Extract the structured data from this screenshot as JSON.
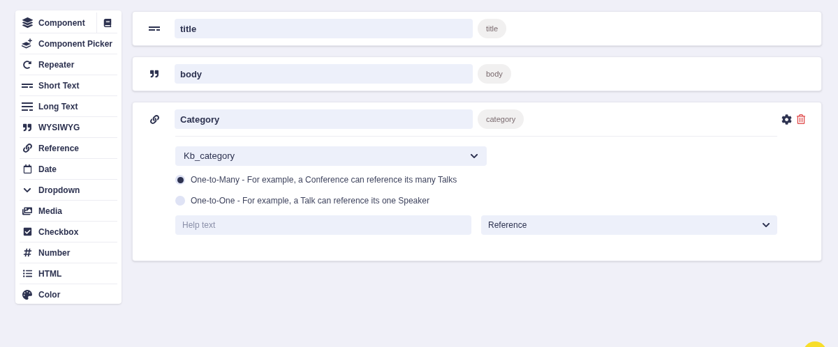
{
  "sidebar": {
    "items": [
      {
        "kind": "component",
        "label": "Component"
      },
      {
        "kind": "picker",
        "label": "Component Picker"
      },
      {
        "kind": "repeater",
        "label": "Repeater"
      },
      {
        "kind": "short_text",
        "label": "Short Text"
      },
      {
        "kind": "long_text",
        "label": "Long Text"
      },
      {
        "kind": "wysiwyg",
        "label": "WYSIWYG"
      },
      {
        "kind": "reference",
        "label": "Reference"
      },
      {
        "kind": "date",
        "label": "Date"
      },
      {
        "kind": "dropdown",
        "label": "Dropdown"
      },
      {
        "kind": "media",
        "label": "Media"
      },
      {
        "kind": "checkbox",
        "label": "Checkbox"
      },
      {
        "kind": "number",
        "label": "Number"
      },
      {
        "kind": "html",
        "label": "HTML"
      },
      {
        "kind": "color",
        "label": "Color"
      }
    ]
  },
  "fields": [
    {
      "kind": "short_text",
      "name": "title",
      "key": "title",
      "expanded": false
    },
    {
      "kind": "wysiwyg",
      "name": "body",
      "key": "body",
      "expanded": false
    },
    {
      "kind": "reference",
      "name": "Category",
      "key": "category",
      "expanded": true,
      "collection": "Kb_category",
      "relations": [
        {
          "label": "One-to-Many - For example, a Conference can reference its many Talks",
          "selected": true
        },
        {
          "label": "One-to-One - For example, a Talk can reference its one Speaker",
          "selected": false
        }
      ],
      "help": {
        "placeholder": "Help text"
      },
      "type_select": "Reference"
    }
  ]
}
